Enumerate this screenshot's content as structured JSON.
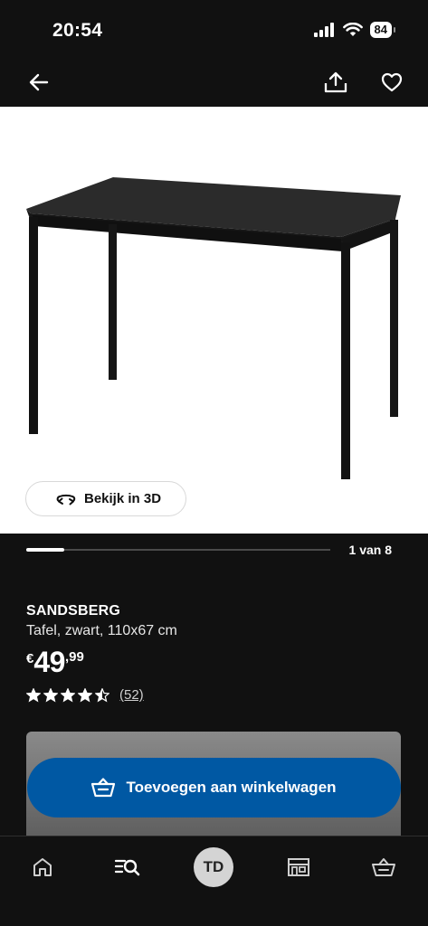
{
  "status_bar": {
    "time": "20:54",
    "battery": "84"
  },
  "carousel": {
    "counter": "1 van 8",
    "progress_fraction": 0.125
  },
  "view_3d": {
    "label": "Bekijk in 3D"
  },
  "product": {
    "name": "SANDSBERG",
    "description": "Tafel, zwart, 110x67 cm",
    "price": {
      "currency": "€",
      "whole": "49",
      "decimal": ",99"
    },
    "rating": {
      "stars": 4.5,
      "max": 5,
      "review_count": "(52)"
    }
  },
  "cart_button": {
    "label": "Toevoegen aan winkelwagen"
  },
  "bottom_nav": {
    "avatar_initials": "TD"
  },
  "colors": {
    "background": "#111111",
    "accent_blue": "#0058a3"
  }
}
